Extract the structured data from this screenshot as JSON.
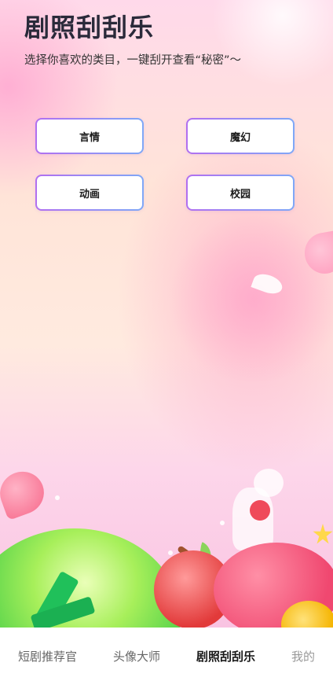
{
  "page": {
    "title": "剧照刮刮乐",
    "subtitle": "选择你喜欢的类目，一键刮开查看“秘密”～"
  },
  "categories": [
    {
      "label": "言情"
    },
    {
      "label": "魔幻"
    },
    {
      "label": "动画"
    },
    {
      "label": "校园"
    }
  ],
  "tabs": [
    {
      "label": "短剧推荐官"
    },
    {
      "label": "头像大师"
    },
    {
      "label": "剧照刮刮乐"
    },
    {
      "label": "我的"
    }
  ],
  "active_tab": "剧照刮刮乐",
  "colors": {
    "button_border_start": "#b16ff0",
    "button_border_end": "#7fa8f7",
    "title": "#2a2a3a",
    "tab_active": "#1a1a1a",
    "tab_inactive": "#666666"
  }
}
